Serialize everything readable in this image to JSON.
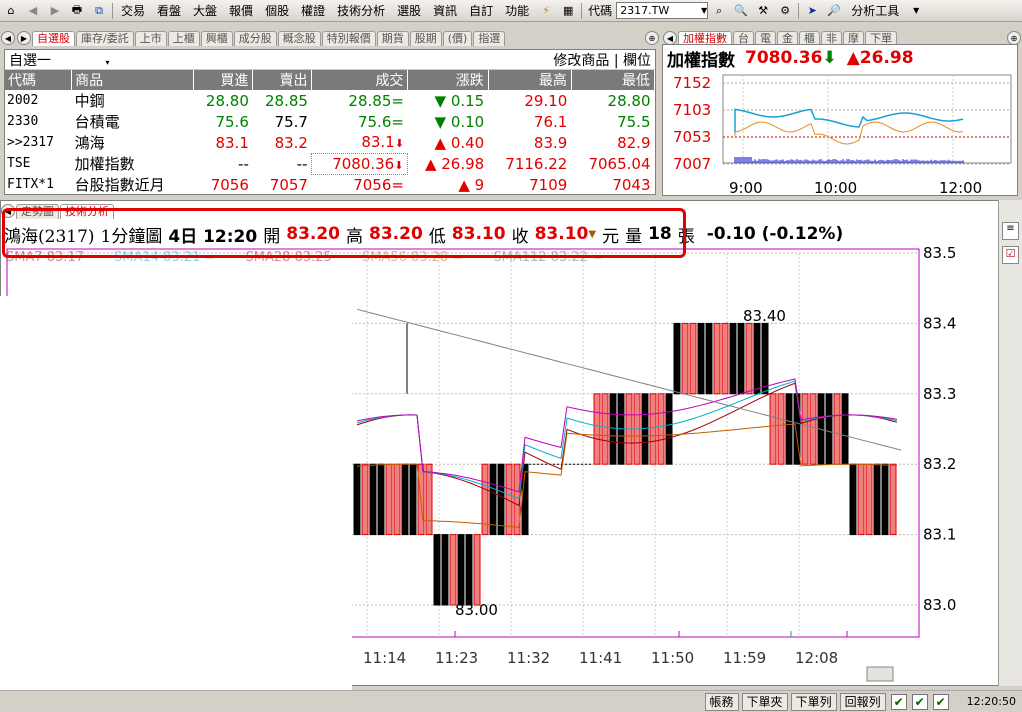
{
  "toolbar": {
    "menus": [
      "交易",
      "看盤",
      "大盤",
      "報價",
      "個股",
      "權證",
      "技術分析",
      "選股",
      "資訊",
      "自訂",
      "功能"
    ],
    "code_label": "代碼",
    "code_value": "2317.TW",
    "analysis_tools": "分析工具"
  },
  "quote": {
    "tabs": [
      "自選股",
      "庫存/委託",
      "上市",
      "上櫃",
      "興櫃",
      "成分股",
      "概念股",
      "特別報價",
      "期貨",
      "股期",
      "(價)",
      "指選"
    ],
    "watchlist": "自選一",
    "modify_label": "修改商品",
    "column_label": "欄位",
    "columns": [
      "代碼",
      "商品",
      "買進",
      "賣出",
      "成交",
      "漲跌",
      "最高",
      "最低"
    ],
    "rows": [
      {
        "code": "2002",
        "name": "中鋼",
        "bid": "28.80",
        "ask": "28.85",
        "last": "28.85=",
        "chg": "0.15",
        "chg_dir": "down",
        "high": "29.10",
        "low": "28.80",
        "color": "green"
      },
      {
        "code": "2330",
        "name": "台積電",
        "bid": "75.6",
        "ask": "75.7",
        "last": "75.6=",
        "chg": "0.10",
        "chg_dir": "down",
        "high": "76.1",
        "low": "75.5",
        "color": "green"
      },
      {
        "code": ">>2317",
        "name": "鴻海",
        "bid": "83.1",
        "ask": "83.2",
        "last": "83.1",
        "chg": "0.40",
        "chg_dir": "up",
        "high": "83.9",
        "low": "82.9",
        "color": "red"
      },
      {
        "code": "TSE",
        "name": "加權指數",
        "bid": "--",
        "ask": "--",
        "last": "7080.36",
        "chg": "26.98",
        "chg_dir": "up",
        "high": "7116.22",
        "low": "7065.04",
        "color": "red"
      },
      {
        "code": "FITX*1",
        "name": "台股指數近月",
        "bid": "7056",
        "ask": "7057",
        "last": "7056=",
        "chg": "9",
        "chg_dir": "up",
        "high": "7109",
        "low": "7043",
        "color": "red"
      }
    ]
  },
  "index": {
    "tabs": [
      "加權指數",
      "台",
      "電",
      "金",
      "櫃",
      "非",
      "摩",
      "下單"
    ],
    "title": "加權指數",
    "value": "7080.36",
    "change": "26.98",
    "y_labels": [
      "7152",
      "7103",
      "7053",
      "7007"
    ],
    "x_labels": [
      "9:00",
      "10:00",
      "12:00"
    ]
  },
  "chart": {
    "tabs": [
      "走勢圖",
      "技術分析"
    ],
    "stock": "鴻海(2317)",
    "period": "1分鐘圖",
    "date": "4日 12:20",
    "open_label": "開",
    "open": "83.20",
    "high_label": "高",
    "high": "83.20",
    "low_label": "低",
    "low": "83.10",
    "close_label": "收",
    "close": "83.10",
    "unit": "元",
    "vol_label": "量",
    "vol": "18",
    "vol_unit": "張",
    "change": "-0.10 (-0.12%)",
    "sma": [
      "SMA7 83.17",
      "SMA14 83.21 =",
      "SMA28 83.25",
      "SMA56 83.28 =",
      "SMA112 83.22 ="
    ],
    "annot_high": "83.40",
    "annot_low": "83.00",
    "y_labels": [
      "83.5",
      "83.4",
      "83.3",
      "83.2",
      "83.1",
      "83.0"
    ],
    "x_labels": [
      "11:14",
      "11:23",
      "11:32",
      "11:41",
      "11:50",
      "11:59",
      "12:08"
    ]
  },
  "status": {
    "buttons": [
      "帳務",
      "下單夾",
      "下單列",
      "回報列"
    ],
    "time": "12:20:50"
  },
  "colors": {
    "up": "#e00000",
    "down": "#008000",
    "accent": "#e00000"
  }
}
